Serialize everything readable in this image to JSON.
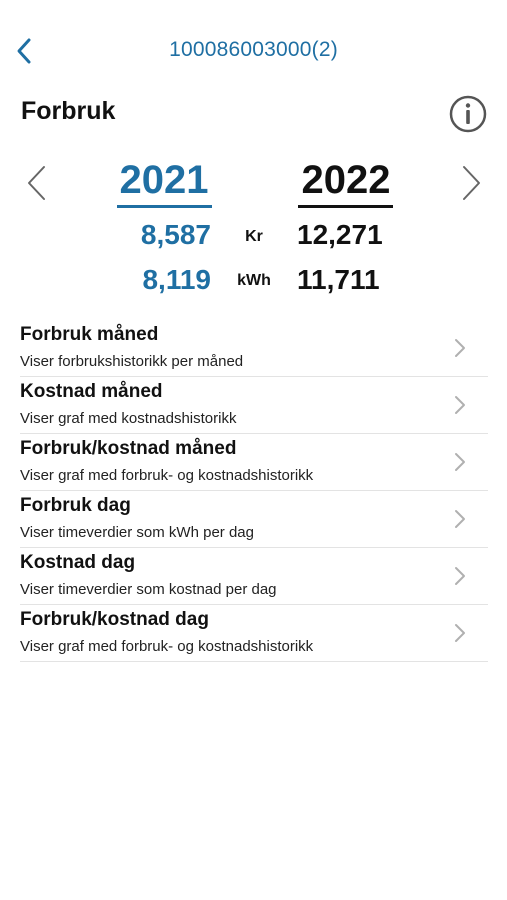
{
  "nav": {
    "title": "100086003000(2)",
    "back_icon": "chevron-left-icon"
  },
  "page": {
    "title": "Forbruk",
    "info_icon": "info-circle-icon"
  },
  "comparison": {
    "left_year": "2021",
    "right_year": "2022",
    "cost_unit": "Kr",
    "energy_unit": "kWh",
    "left_cost": "8,587",
    "right_cost": "12,271",
    "left_energy": "8,119",
    "right_energy": "11,711",
    "prev_icon": "chevron-left-icon",
    "next_icon": "chevron-right-icon"
  },
  "menu": [
    {
      "title": "Forbruk måned",
      "subtitle": "Viser forbrukshistorikk per måned"
    },
    {
      "title": "Kostnad måned",
      "subtitle": "Viser graf med kostnadshistorikk"
    },
    {
      "title": "Forbruk/kostnad måned",
      "subtitle": "Viser graf med forbruk- og kostnadshistorikk"
    },
    {
      "title": "Forbruk dag",
      "subtitle": "Viser timeverdier som kWh per dag"
    },
    {
      "title": "Kostnad dag",
      "subtitle": "Viser timeverdier som kostnad per dag"
    },
    {
      "title": "Forbruk/kostnad dag",
      "subtitle": "Viser graf med forbruk- og kostnadshistorikk"
    }
  ],
  "colors": {
    "accent": "#1f6fa3",
    "text": "#111111",
    "chevron": "#b0b0b0",
    "divider": "#e3e3e3"
  }
}
